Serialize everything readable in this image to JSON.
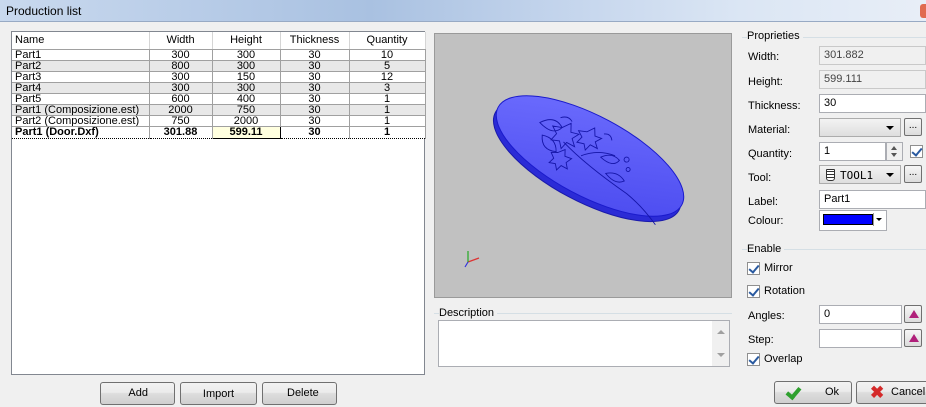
{
  "window": {
    "title": "Production list"
  },
  "grid": {
    "columns": [
      "Name",
      "Width",
      "Height",
      "Thickness",
      "Quantity"
    ],
    "rows": [
      [
        "Part1",
        "300",
        "300",
        "30",
        "10"
      ],
      [
        "Part2",
        "800",
        "300",
        "30",
        "5"
      ],
      [
        "Part3",
        "300",
        "150",
        "30",
        "12"
      ],
      [
        "Part4",
        "300",
        "300",
        "30",
        "3"
      ],
      [
        "Part5",
        "600",
        "400",
        "30",
        "1"
      ],
      [
        "Part1 (Composizione.est)",
        "2000",
        "750",
        "30",
        "1"
      ],
      [
        "Part2 (Composizione.est)",
        "750",
        "2000",
        "30",
        "1"
      ],
      [
        "Part1 (Door.Dxf)",
        "301.88",
        "599.11",
        "30",
        "1"
      ]
    ],
    "selected_row": 7
  },
  "description": {
    "label": "Description",
    "value": ""
  },
  "properties": {
    "title": "Proprieties",
    "width_label": "Width:",
    "width_value": "301.882",
    "height_label": "Height:",
    "height_value": "599.111",
    "thickness_label": "Thickness:",
    "thickness_value": "30",
    "material_label": "Material:",
    "material_value": "",
    "quantity_label": "Quantity:",
    "quantity_value": "1",
    "tool_label": "Tool:",
    "tool_value": "TOOL1",
    "label_label": "Label:",
    "label_value": "Part1",
    "colour_label": "Colour:",
    "colour_value": "#0000ff",
    "browse_label": "...",
    "quantity_checked": true
  },
  "enable": {
    "title": "Enable",
    "mirror_label": "Mirror",
    "mirror_checked": true,
    "rotation_label": "Rotation",
    "rotation_checked": true,
    "angles_label": "Angles:",
    "angles_value": "0",
    "step_label": "Step:",
    "step_value": "",
    "overlap_label": "Overlap",
    "overlap_checked": true
  },
  "buttons": {
    "add": "Add",
    "import": "Import",
    "delete": "Delete",
    "ok": "Ok",
    "cancel": "Cancel"
  },
  "colors": {
    "part_fill": "#5a5aff",
    "part_edge": "#1a1acc",
    "preview_bg": "#c1c1c1"
  }
}
